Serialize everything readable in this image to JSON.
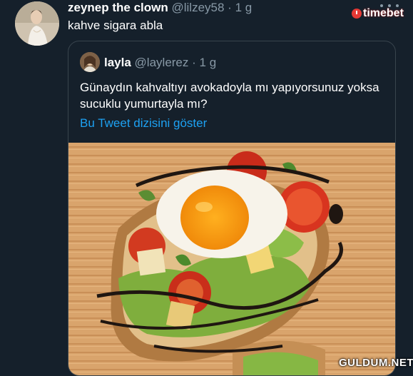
{
  "tweet": {
    "author_name": "zeynep the clown",
    "handle": "@lilzey58",
    "separator": "·",
    "time": "1 g",
    "text": "kahve sigara abla"
  },
  "quoted_tweet": {
    "author_name": "layla",
    "handle": "@laylerez",
    "separator": "·",
    "time": "1 g",
    "text": "Günaydın kahvaltıyı avokadoyla mı yapıyorsunuz yoksa sucuklu yumurtayla mı?",
    "thread_link": "Bu Tweet dizisini göster"
  },
  "overlays": {
    "brand_logo": "timebet",
    "watermark": "GULDUM.NET"
  },
  "icons": {
    "more": "more-dots-icon"
  },
  "colors": {
    "background": "#15202b",
    "link": "#1da1f2",
    "muted": "#8899a6"
  }
}
